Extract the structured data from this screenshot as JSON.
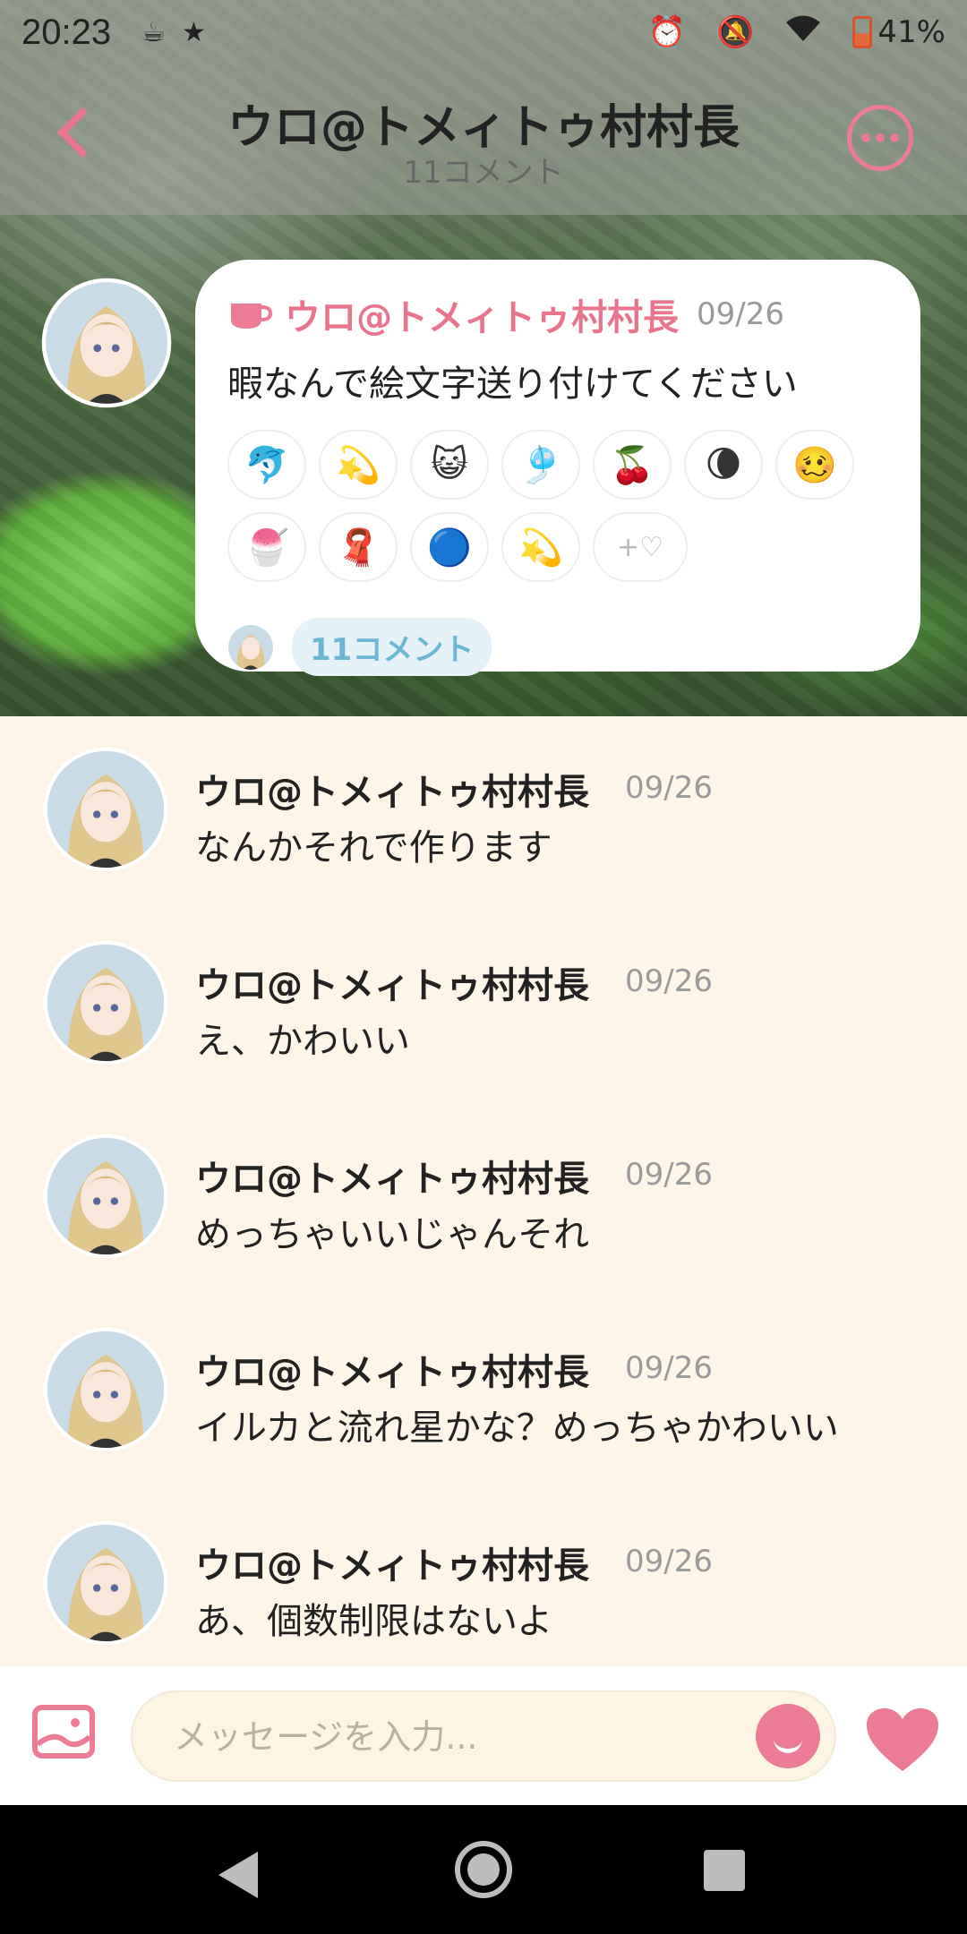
{
  "status_bar": {
    "time": "20:23",
    "battery": "41%",
    "icons": [
      "coffee-icon",
      "star-icon",
      "alarm-icon",
      "bell-off-icon",
      "wifi-icon",
      "battery-icon"
    ]
  },
  "header": {
    "title": "ウロ@トメィトゥ村村長",
    "subtitle": "11コメント"
  },
  "post": {
    "author": "ウロ@トメィトゥ村村長",
    "date": "09/26",
    "text": "暇なんで絵文字送り付けてください",
    "emojis": [
      "🐬",
      "💫",
      "😺",
      "🎐",
      "🍒",
      "🌘",
      "🥴",
      "🍧",
      "🧣",
      "🔵",
      "💫"
    ],
    "add_reaction_label": "+♡",
    "comment_count_label": "11コメント"
  },
  "comments": [
    {
      "name": "ウロ@トメィトゥ村村長",
      "date": "09/26",
      "text": "なんかそれで作ります"
    },
    {
      "name": "ウロ@トメィトゥ村村長",
      "date": "09/26",
      "text": "え、かわいい"
    },
    {
      "name": "ウロ@トメィトゥ村村長",
      "date": "09/26",
      "text": "めっちゃいいじゃんそれ"
    },
    {
      "name": "ウロ@トメィトゥ村村長",
      "date": "09/26",
      "text": "イルカと流れ星かな？めっちゃかわいい"
    },
    {
      "name": "ウロ@トメィトゥ村村長",
      "date": "09/26",
      "text": "あ、個数制限はないよ"
    }
  ],
  "input": {
    "placeholder": "メッセージを入力..."
  },
  "colors": {
    "accent": "#ec7b95",
    "background": "#fdf6e8",
    "pill": "#e5f3f8"
  }
}
